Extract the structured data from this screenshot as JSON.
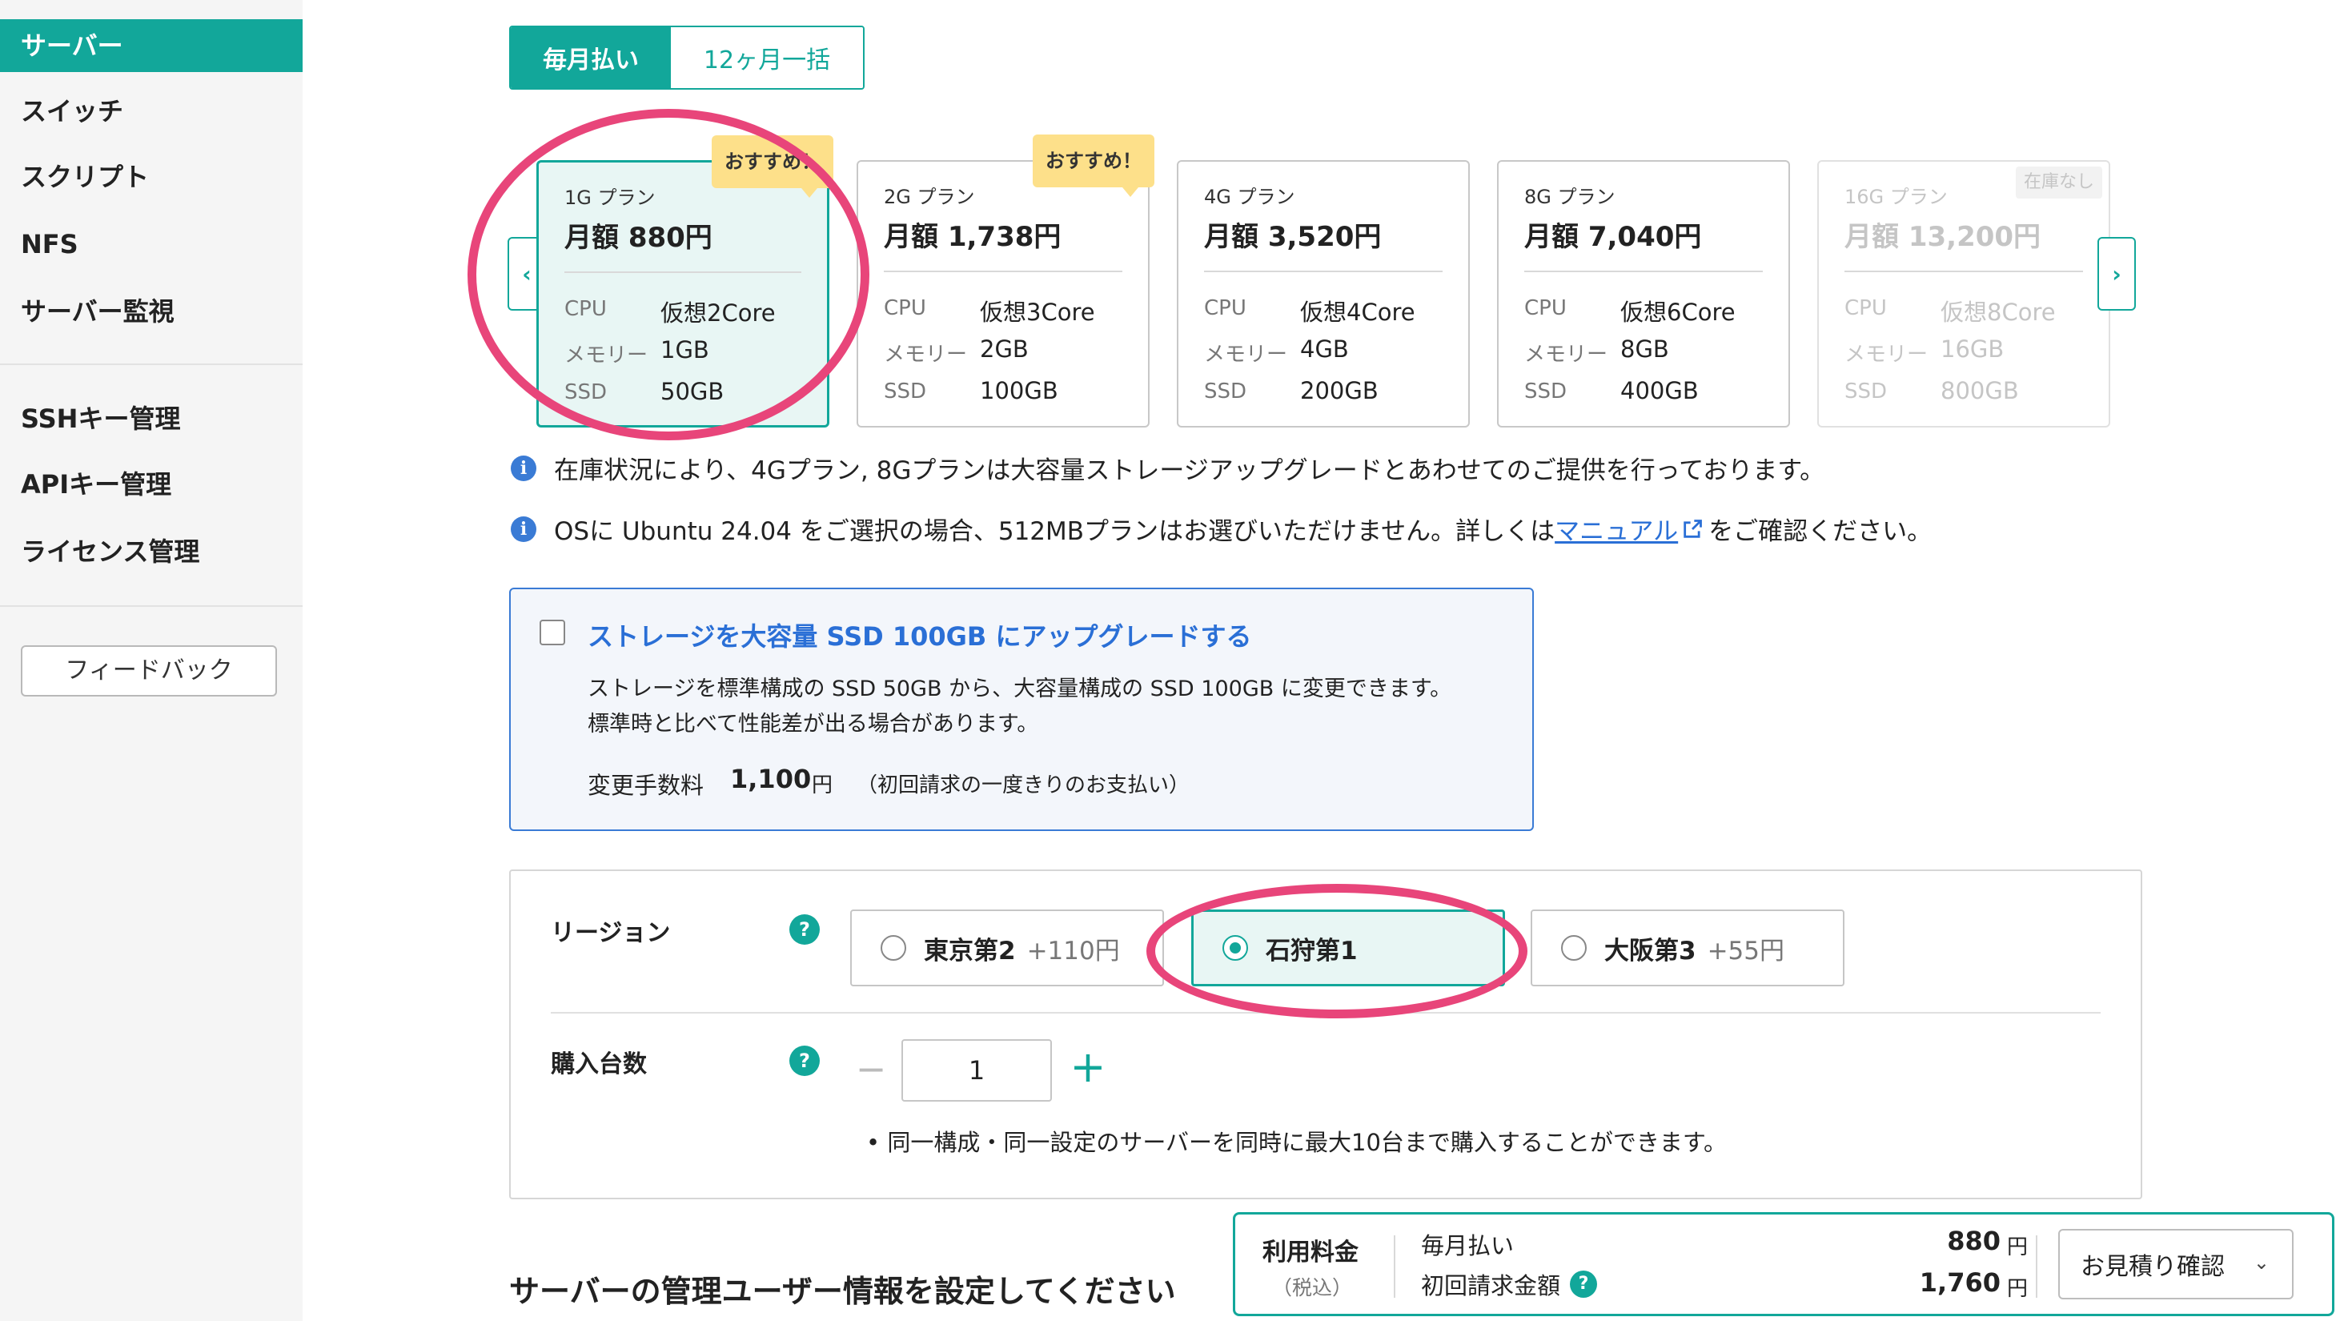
{
  "sidebar": {
    "items": [
      {
        "label": "サーバー",
        "active": true
      },
      {
        "label": "スイッチ"
      },
      {
        "label": "スクリプト"
      },
      {
        "label": "NFS"
      },
      {
        "label": "サーバー監視"
      },
      {
        "label": "SSHキー管理"
      },
      {
        "label": "APIキー管理"
      },
      {
        "label": "ライセンス管理"
      }
    ],
    "feedback_label": "フィードバック"
  },
  "payment_tabs": {
    "monthly": "毎月払い",
    "yearly": "12ヶ月一括",
    "selected": "monthly"
  },
  "plans": [
    {
      "name": "1G プラン",
      "price": "月額 880円",
      "cpu": "仮想2Core",
      "memory": "1GB",
      "ssd": "50GB",
      "badge": "おすすめ！",
      "selected": true
    },
    {
      "name": "2G プラン",
      "price": "月額 1,738円",
      "cpu": "仮想3Core",
      "memory": "2GB",
      "ssd": "100GB",
      "badge": "おすすめ！"
    },
    {
      "name": "4G プラン",
      "price": "月額 3,520円",
      "cpu": "仮想4Core",
      "memory": "4GB",
      "ssd": "200GB"
    },
    {
      "name": "8G プラン",
      "price": "月額 7,040円",
      "cpu": "仮想6Core",
      "memory": "8GB",
      "ssd": "400GB"
    },
    {
      "name": "16G プラン",
      "price": "月額 13,200円",
      "cpu": "仮想8Core",
      "memory": "16GB",
      "ssd": "800GB",
      "stock": "在庫なし",
      "disabled": true
    }
  ],
  "spec_labels": {
    "cpu": "CPU",
    "memory": "メモリー",
    "ssd": "SSD"
  },
  "info": {
    "line1": "在庫状況により、4Gプラン, 8Gプランは大容量ストレージアップグレードとあわせてのご提供を行っております。",
    "line2_before": "OSに Ubuntu 24.04 をご選択の場合、512MBプランはお選びいただけません。詳しくは",
    "line2_link": "マニュアル",
    "line2_after": "をご確認ください。"
  },
  "upgrade": {
    "title": "ストレージを大容量 SSD 100GB にアップグレードする",
    "desc1": "ストレージを標準構成の SSD 50GB から、大容量構成の SSD 100GB に変更できます。",
    "desc2": "標準時と比べて性能差が出る場合があります。",
    "fee_label": "変更手数料",
    "fee_value": "1,100",
    "fee_unit": "円",
    "fee_note": "（初回請求の一度きりのお支払い）",
    "checked": false
  },
  "region": {
    "label": "リージョン",
    "options": [
      {
        "name": "東京第2",
        "extra": "+110円"
      },
      {
        "name": "石狩第1",
        "extra": "",
        "selected": true
      },
      {
        "name": "大阪第3",
        "extra": "+55円"
      }
    ]
  },
  "quantity": {
    "label": "購入台数",
    "value": "1",
    "note": "• 同一構成・同一設定のサーバーを同時に最大10台まで購入することができます。"
  },
  "section_title": "サーバーの管理ユーザー情報を設定してください",
  "price_bar": {
    "label": "利用料金",
    "tax": "（税込）",
    "monthly_label": "毎月払い",
    "monthly_amount": "880",
    "initial_label": "初回請求金額",
    "initial_amount": "1,760",
    "unit": "円",
    "estimate_button": "お見積り確認"
  },
  "colors": {
    "accent": "#12a79a",
    "link": "#2a6fd6",
    "highlight_ring": "#e8457a",
    "badge": "#fde08a"
  }
}
